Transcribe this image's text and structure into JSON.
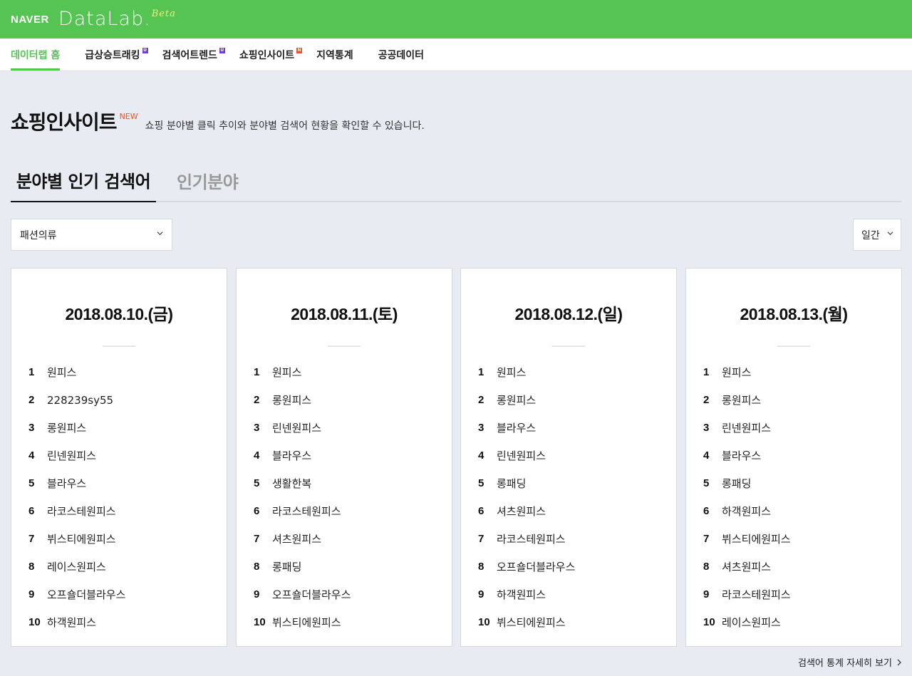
{
  "header": {
    "naver": "NAVER",
    "datalab": "DataLab.",
    "beta": "Beta"
  },
  "nav": [
    {
      "label": "데이터랩 홈",
      "badge": ""
    },
    {
      "label": "급상승트래킹",
      "badge": "U"
    },
    {
      "label": "검색어트렌드",
      "badge": "U"
    },
    {
      "label": "쇼핑인사이트",
      "badge": "N"
    },
    {
      "label": "지역통계",
      "badge": ""
    },
    {
      "label": "공공데이터",
      "badge": ""
    }
  ],
  "page": {
    "title": "쇼핑인사이트",
    "new_tag": "NEW",
    "description": "쇼핑 분야별 클릭 추이와 분야별 검색어 현황을 확인할 수 있습니다."
  },
  "tabs": {
    "active": "분야별 인기 검색어",
    "inactive": "인기분야"
  },
  "filters": {
    "category": "패션의류",
    "period": "일간"
  },
  "cards": [
    {
      "date": "2018.08.10.(금)",
      "items": [
        {
          "rank": "1",
          "keyword": "원피스"
        },
        {
          "rank": "2",
          "keyword": "228239sy55"
        },
        {
          "rank": "3",
          "keyword": "롱원피스"
        },
        {
          "rank": "4",
          "keyword": "린넨원피스"
        },
        {
          "rank": "5",
          "keyword": "블라우스"
        },
        {
          "rank": "6",
          "keyword": "라코스테원피스"
        },
        {
          "rank": "7",
          "keyword": "뷔스티에원피스"
        },
        {
          "rank": "8",
          "keyword": "레이스원피스"
        },
        {
          "rank": "9",
          "keyword": "오프숄더블라우스"
        },
        {
          "rank": "10",
          "keyword": "하객원피스"
        }
      ]
    },
    {
      "date": "2018.08.11.(토)",
      "items": [
        {
          "rank": "1",
          "keyword": "원피스"
        },
        {
          "rank": "2",
          "keyword": "롱원피스"
        },
        {
          "rank": "3",
          "keyword": "린넨원피스"
        },
        {
          "rank": "4",
          "keyword": "블라우스"
        },
        {
          "rank": "5",
          "keyword": "생활한복"
        },
        {
          "rank": "6",
          "keyword": "라코스테원피스"
        },
        {
          "rank": "7",
          "keyword": "셔츠원피스"
        },
        {
          "rank": "8",
          "keyword": "롱패딩"
        },
        {
          "rank": "9",
          "keyword": "오프숄더블라우스"
        },
        {
          "rank": "10",
          "keyword": "뷔스티에원피스"
        }
      ]
    },
    {
      "date": "2018.08.12.(일)",
      "items": [
        {
          "rank": "1",
          "keyword": "원피스"
        },
        {
          "rank": "2",
          "keyword": "롱원피스"
        },
        {
          "rank": "3",
          "keyword": "블라우스"
        },
        {
          "rank": "4",
          "keyword": "린넨원피스"
        },
        {
          "rank": "5",
          "keyword": "롱패딩"
        },
        {
          "rank": "6",
          "keyword": "셔츠원피스"
        },
        {
          "rank": "7",
          "keyword": "라코스테원피스"
        },
        {
          "rank": "8",
          "keyword": "오프숄더블라우스"
        },
        {
          "rank": "9",
          "keyword": "하객원피스"
        },
        {
          "rank": "10",
          "keyword": "뷔스티에원피스"
        }
      ]
    },
    {
      "date": "2018.08.13.(월)",
      "items": [
        {
          "rank": "1",
          "keyword": "원피스"
        },
        {
          "rank": "2",
          "keyword": "롱원피스"
        },
        {
          "rank": "3",
          "keyword": "린넨원피스"
        },
        {
          "rank": "4",
          "keyword": "블라우스"
        },
        {
          "rank": "5",
          "keyword": "롱패딩"
        },
        {
          "rank": "6",
          "keyword": "하객원피스"
        },
        {
          "rank": "7",
          "keyword": "뷔스티에원피스"
        },
        {
          "rank": "8",
          "keyword": "셔츠원피스"
        },
        {
          "rank": "9",
          "keyword": "라코스테원피스"
        },
        {
          "rank": "10",
          "keyword": "레이스원피스"
        }
      ]
    }
  ],
  "footer": {
    "more_link": "검색어 통계 자세히 보기"
  },
  "colors": {
    "brand_green": "#55c453",
    "badge_update": "#6a3fd6",
    "badge_new": "#e8542c",
    "background": "#e8ebf1"
  }
}
